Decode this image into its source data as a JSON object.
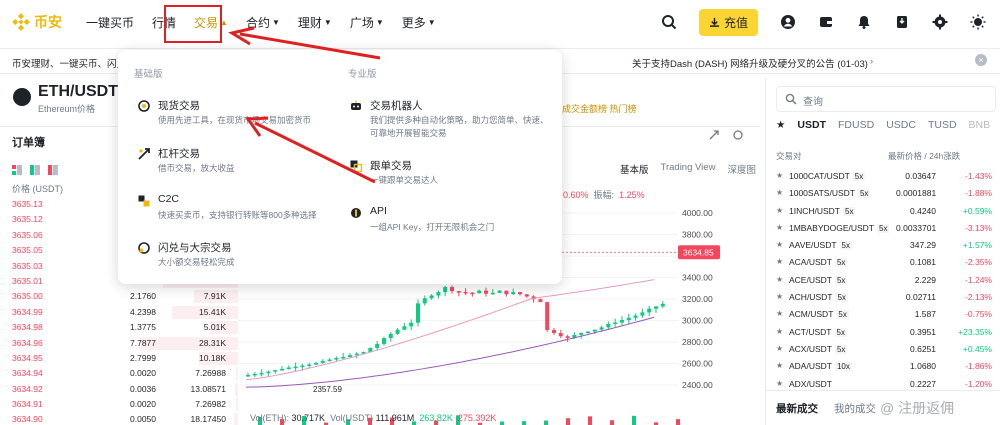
{
  "nav": {
    "brand": "币安",
    "items": [
      {
        "label": "一键买币",
        "caret": false
      },
      {
        "label": "行情",
        "caret": false
      },
      {
        "label": "交易",
        "caret": "up",
        "active": true
      },
      {
        "label": "合约",
        "caret": "down"
      },
      {
        "label": "理财",
        "caret": "down"
      },
      {
        "label": "广场",
        "caret": "down"
      },
      {
        "label": "更多",
        "caret": "down"
      }
    ],
    "deposit_label": "充值",
    "icons": [
      "search-icon",
      "user-icon",
      "wallet-icon",
      "bell-icon",
      "download-icon",
      "settings-icon",
      "theme-icon"
    ]
  },
  "announcement": {
    "left": "币安理财、一键买币、闪兑",
    "right": "关于支持Dash (DASH) 网络升级及硬分叉的公告 (01-03)"
  },
  "symbol": {
    "pair": "ETH/USDT",
    "subtitle": "Ethereum价格",
    "tags": "成交金额榜  热门榜"
  },
  "orderbook": {
    "title": "订单簿",
    "header_price": "价格 (USDT)",
    "rows": [
      {
        "price": "3635.13",
        "amount": "",
        "total": ""
      },
      {
        "price": "3635.12",
        "amount": "",
        "total": ""
      },
      {
        "price": "3635.06",
        "amount": "",
        "total": ""
      },
      {
        "price": "3635.05",
        "amount": "",
        "total": ""
      },
      {
        "price": "3635.03",
        "amount": "",
        "total": ""
      },
      {
        "price": "3635.01",
        "amount": "",
        "total": ""
      },
      {
        "price": "3635.00",
        "amount": "2.1760",
        "total": "7.91K"
      },
      {
        "price": "3634.99",
        "amount": "4.2398",
        "total": "15.41K"
      },
      {
        "price": "3634.98",
        "amount": "1.3775",
        "total": "5.01K"
      },
      {
        "price": "3634.96",
        "amount": "7.7877",
        "total": "28.31K"
      },
      {
        "price": "3634.95",
        "amount": "2.7999",
        "total": "10.18K"
      },
      {
        "price": "3634.94",
        "amount": "0.0020",
        "total": "7.26988"
      },
      {
        "price": "3634.92",
        "amount": "0.0036",
        "total": "13.08571"
      },
      {
        "price": "3634.91",
        "amount": "0.0020",
        "total": "7.26982"
      },
      {
        "price": "3634.90",
        "amount": "0.0050",
        "total": "18.17450"
      },
      {
        "price": "3634.89",
        "amount": "5.0985",
        "total": "18.53K"
      }
    ],
    "depth": [
      0.7,
      0.3,
      0.22,
      0.5,
      0.4,
      0.68,
      0.4,
      0.6,
      0.25,
      0.9,
      0.35,
      0.02,
      0.03,
      0.02,
      0.04,
      0.45
    ]
  },
  "chart": {
    "tools": [
      "基本版",
      "Trading View",
      "深度图"
    ],
    "change_pct": "0.60%",
    "amplitude_label": "振幅:",
    "amplitude": "1.25%",
    "y_ticks": [
      "4000.00",
      "3800.00",
      "3600.00",
      "3400.00",
      "3200.00",
      "3000.00",
      "2800.00",
      "2600.00",
      "2400.00"
    ],
    "current_price": "3634.85",
    "low_label": "2357.59",
    "vol_label": "Vol(ETH):",
    "vol_eth": "30.717K",
    "vol_usdt_label": "Vol(USDT)",
    "vol_usdt": "111.961M",
    "vol_g": "263.82K",
    "vol_r": "275.392K"
  },
  "market": {
    "search_placeholder": "查询",
    "tabs": [
      "USDT",
      "FDUSD",
      "USDC",
      "TUSD",
      "BNB"
    ],
    "header_pair": "交易对",
    "header_price": "最新价格 / 24h涨跌",
    "rows": [
      {
        "sym": "1000CAT/USDT",
        "lev": "5x",
        "price": "0.03647",
        "chg": "-1.43%",
        "dir": "down"
      },
      {
        "sym": "1000SATS/USDT",
        "lev": "5x",
        "price": "0.0001881",
        "chg": "-1.88%",
        "dir": "down"
      },
      {
        "sym": "1INCH/USDT",
        "lev": "5x",
        "price": "0.4240",
        "chg": "+0.59%",
        "dir": "up"
      },
      {
        "sym": "1MBABYDOGE/USDT",
        "lev": "5x",
        "price": "0.0033701",
        "chg": "-3.13%",
        "dir": "down"
      },
      {
        "sym": "AAVE/USDT",
        "lev": "5x",
        "price": "347.29",
        "chg": "+1.57%",
        "dir": "up"
      },
      {
        "sym": "ACA/USDT",
        "lev": "5x",
        "price": "0.1081",
        "chg": "-2.35%",
        "dir": "down"
      },
      {
        "sym": "ACE/USDT",
        "lev": "5x",
        "price": "2.229",
        "chg": "-1.24%",
        "dir": "down"
      },
      {
        "sym": "ACH/USDT",
        "lev": "5x",
        "price": "0.02711",
        "chg": "-2.13%",
        "dir": "down"
      },
      {
        "sym": "ACM/USDT",
        "lev": "5x",
        "price": "1.587",
        "chg": "-0.75%",
        "dir": "down"
      },
      {
        "sym": "ACT/USDT",
        "lev": "5x",
        "price": "0.3951",
        "chg": "+23.35%",
        "dir": "up"
      },
      {
        "sym": "ACX/USDT",
        "lev": "5x",
        "price": "0.6251",
        "chg": "+0.45%",
        "dir": "up"
      },
      {
        "sym": "ADA/USDT",
        "lev": "10x",
        "price": "1.0680",
        "chg": "-1.86%",
        "dir": "down"
      },
      {
        "sym": "ADX/USDT",
        "lev": "",
        "price": "0.2227",
        "chg": "-1.20%",
        "dir": "down"
      }
    ],
    "bottom_tabs": [
      "最新成交",
      "我的成交"
    ]
  },
  "watermark": "@ 注册返佣",
  "menu": {
    "basic": "基础版",
    "pro": "专业版",
    "items": [
      {
        "title": "现货交易",
        "desc": "使用先进工具，在现货市场交易加密货币",
        "icon": "spot-icon"
      },
      {
        "title": "杠杆交易",
        "desc": "借币交易，放大收益",
        "icon": "margin-icon"
      },
      {
        "title": "C2C",
        "desc": "快速买卖币，支持银行转账等800多种选择",
        "icon": "c2c-icon"
      },
      {
        "title": "闪兑与大宗交易",
        "desc": "大小额交易轻松完成",
        "icon": "convert-icon"
      },
      {
        "title": "交易机器人",
        "desc": "我们提供多种自动化策略，助力您简单、快速、可靠地开展智能交易",
        "icon": "bot-icon"
      },
      {
        "title": "跟单交易",
        "desc": "一键跟单交易达人",
        "icon": "copy-icon"
      },
      {
        "title": "API",
        "desc": "一组API Key，打开无限机会之门",
        "icon": "api-icon"
      }
    ]
  },
  "colors": {
    "brand": "#f0b90b",
    "up": "#0ecb81",
    "down": "#f6465d",
    "annotation": "#e02020"
  }
}
